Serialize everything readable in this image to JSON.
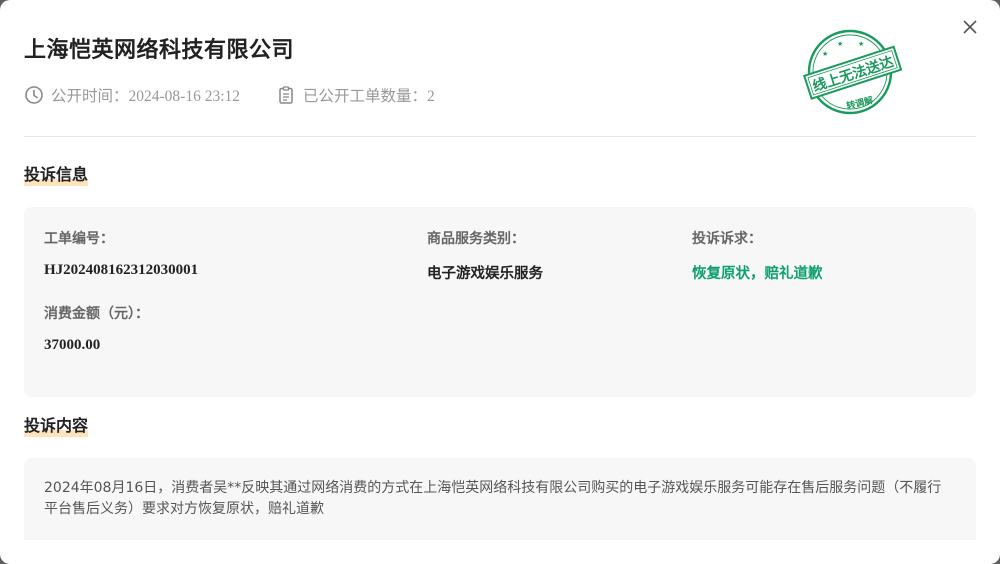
{
  "header": {
    "company_name": "上海恺英网络科技有限公司",
    "publish_time": "公开时间：2024-08-16 23:12",
    "ticket_count": "已公开工单数量：2"
  },
  "stamp": {
    "main_text": "线上无法送达",
    "sub_text": "转调解",
    "color": "#1a9a5c"
  },
  "sections": {
    "info_title": "投诉信息",
    "content_title": "投诉内容"
  },
  "info": {
    "ticket_no_label": "工单编号：",
    "ticket_no_value": "HJ202408162312030001",
    "category_label": "商品服务类别：",
    "category_value": "电子游戏娱乐服务",
    "demand_label": "投诉诉求：",
    "demand_value": "恢复原状，赔礼道歉",
    "amount_label": "消费金额（元）：",
    "amount_value": "37000.00"
  },
  "content": {
    "text": "2024年08月16日，消费者吴**反映其通过网络消费的方式在上海恺英网络科技有限公司购买的电子游戏娱乐服务可能存在售后服务问题（不履行平台售后义务）要求对方恢复原状，赔礼道歉"
  },
  "icons": {
    "close": "close-icon",
    "clock": "clock-icon",
    "clipboard": "clipboard-icon"
  },
  "colors": {
    "accent_green": "#0e9f6e",
    "highlight": "#fde4bd"
  }
}
